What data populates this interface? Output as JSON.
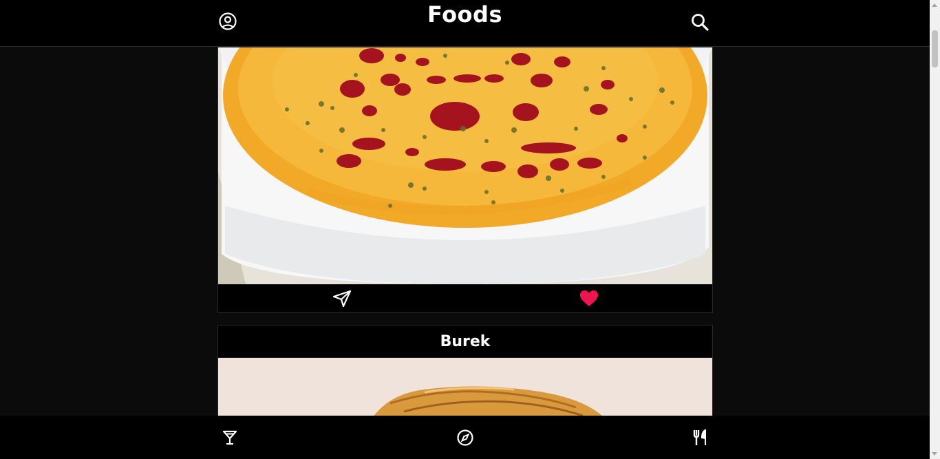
{
  "header": {
    "title": "Foods",
    "profile_icon": "user-circle-icon",
    "search_icon": "search-icon"
  },
  "feed": {
    "cards": [
      {
        "title": "",
        "image": "lentil-soup-photo",
        "actions": {
          "share_icon": "paper-plane-icon",
          "like_icon": "heart-icon",
          "liked": true
        }
      },
      {
        "title": "Burek",
        "image": "burek-pastry-photo"
      }
    ]
  },
  "bottom_nav": {
    "items": [
      {
        "icon": "cocktail-glass-icon"
      },
      {
        "icon": "compass-icon"
      },
      {
        "icon": "fork-knife-icon"
      }
    ]
  },
  "colors": {
    "background": "#0b0b0b",
    "bar": "#000000",
    "like": "#f0154e",
    "text": "#ffffff"
  }
}
